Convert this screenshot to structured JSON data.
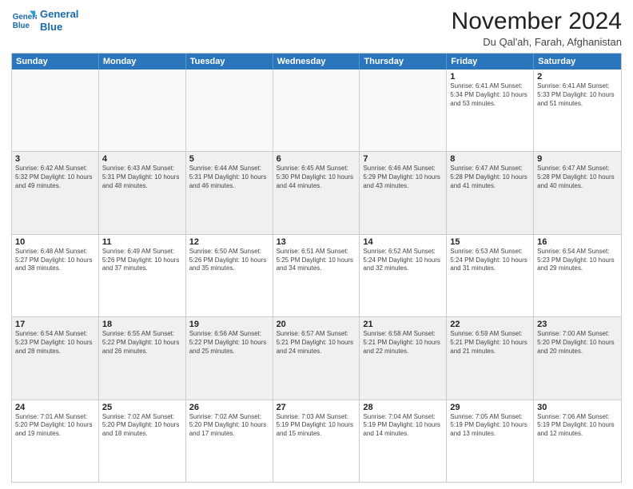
{
  "header": {
    "logo_line1": "General",
    "logo_line2": "Blue",
    "month": "November 2024",
    "location": "Du Qal'ah, Farah, Afghanistan"
  },
  "weekdays": [
    "Sunday",
    "Monday",
    "Tuesday",
    "Wednesday",
    "Thursday",
    "Friday",
    "Saturday"
  ],
  "rows": [
    [
      {
        "day": "",
        "info": ""
      },
      {
        "day": "",
        "info": ""
      },
      {
        "day": "",
        "info": ""
      },
      {
        "day": "",
        "info": ""
      },
      {
        "day": "",
        "info": ""
      },
      {
        "day": "1",
        "info": "Sunrise: 6:41 AM\nSunset: 5:34 PM\nDaylight: 10 hours\nand 53 minutes."
      },
      {
        "day": "2",
        "info": "Sunrise: 6:41 AM\nSunset: 5:33 PM\nDaylight: 10 hours\nand 51 minutes."
      }
    ],
    [
      {
        "day": "3",
        "info": "Sunrise: 6:42 AM\nSunset: 5:32 PM\nDaylight: 10 hours\nand 49 minutes."
      },
      {
        "day": "4",
        "info": "Sunrise: 6:43 AM\nSunset: 5:31 PM\nDaylight: 10 hours\nand 48 minutes."
      },
      {
        "day": "5",
        "info": "Sunrise: 6:44 AM\nSunset: 5:31 PM\nDaylight: 10 hours\nand 46 minutes."
      },
      {
        "day": "6",
        "info": "Sunrise: 6:45 AM\nSunset: 5:30 PM\nDaylight: 10 hours\nand 44 minutes."
      },
      {
        "day": "7",
        "info": "Sunrise: 6:46 AM\nSunset: 5:29 PM\nDaylight: 10 hours\nand 43 minutes."
      },
      {
        "day": "8",
        "info": "Sunrise: 6:47 AM\nSunset: 5:28 PM\nDaylight: 10 hours\nand 41 minutes."
      },
      {
        "day": "9",
        "info": "Sunrise: 6:47 AM\nSunset: 5:28 PM\nDaylight: 10 hours\nand 40 minutes."
      }
    ],
    [
      {
        "day": "10",
        "info": "Sunrise: 6:48 AM\nSunset: 5:27 PM\nDaylight: 10 hours\nand 38 minutes."
      },
      {
        "day": "11",
        "info": "Sunrise: 6:49 AM\nSunset: 5:26 PM\nDaylight: 10 hours\nand 37 minutes."
      },
      {
        "day": "12",
        "info": "Sunrise: 6:50 AM\nSunset: 5:26 PM\nDaylight: 10 hours\nand 35 minutes."
      },
      {
        "day": "13",
        "info": "Sunrise: 6:51 AM\nSunset: 5:25 PM\nDaylight: 10 hours\nand 34 minutes."
      },
      {
        "day": "14",
        "info": "Sunrise: 6:52 AM\nSunset: 5:24 PM\nDaylight: 10 hours\nand 32 minutes."
      },
      {
        "day": "15",
        "info": "Sunrise: 6:53 AM\nSunset: 5:24 PM\nDaylight: 10 hours\nand 31 minutes."
      },
      {
        "day": "16",
        "info": "Sunrise: 6:54 AM\nSunset: 5:23 PM\nDaylight: 10 hours\nand 29 minutes."
      }
    ],
    [
      {
        "day": "17",
        "info": "Sunrise: 6:54 AM\nSunset: 5:23 PM\nDaylight: 10 hours\nand 28 minutes."
      },
      {
        "day": "18",
        "info": "Sunrise: 6:55 AM\nSunset: 5:22 PM\nDaylight: 10 hours\nand 26 minutes."
      },
      {
        "day": "19",
        "info": "Sunrise: 6:56 AM\nSunset: 5:22 PM\nDaylight: 10 hours\nand 25 minutes."
      },
      {
        "day": "20",
        "info": "Sunrise: 6:57 AM\nSunset: 5:21 PM\nDaylight: 10 hours\nand 24 minutes."
      },
      {
        "day": "21",
        "info": "Sunrise: 6:58 AM\nSunset: 5:21 PM\nDaylight: 10 hours\nand 22 minutes."
      },
      {
        "day": "22",
        "info": "Sunrise: 6:59 AM\nSunset: 5:21 PM\nDaylight: 10 hours\nand 21 minutes."
      },
      {
        "day": "23",
        "info": "Sunrise: 7:00 AM\nSunset: 5:20 PM\nDaylight: 10 hours\nand 20 minutes."
      }
    ],
    [
      {
        "day": "24",
        "info": "Sunrise: 7:01 AM\nSunset: 5:20 PM\nDaylight: 10 hours\nand 19 minutes."
      },
      {
        "day": "25",
        "info": "Sunrise: 7:02 AM\nSunset: 5:20 PM\nDaylight: 10 hours\nand 18 minutes."
      },
      {
        "day": "26",
        "info": "Sunrise: 7:02 AM\nSunset: 5:20 PM\nDaylight: 10 hours\nand 17 minutes."
      },
      {
        "day": "27",
        "info": "Sunrise: 7:03 AM\nSunset: 5:19 PM\nDaylight: 10 hours\nand 15 minutes."
      },
      {
        "day": "28",
        "info": "Sunrise: 7:04 AM\nSunset: 5:19 PM\nDaylight: 10 hours\nand 14 minutes."
      },
      {
        "day": "29",
        "info": "Sunrise: 7:05 AM\nSunset: 5:19 PM\nDaylight: 10 hours\nand 13 minutes."
      },
      {
        "day": "30",
        "info": "Sunrise: 7:06 AM\nSunset: 5:19 PM\nDaylight: 10 hours\nand 12 minutes."
      }
    ]
  ]
}
